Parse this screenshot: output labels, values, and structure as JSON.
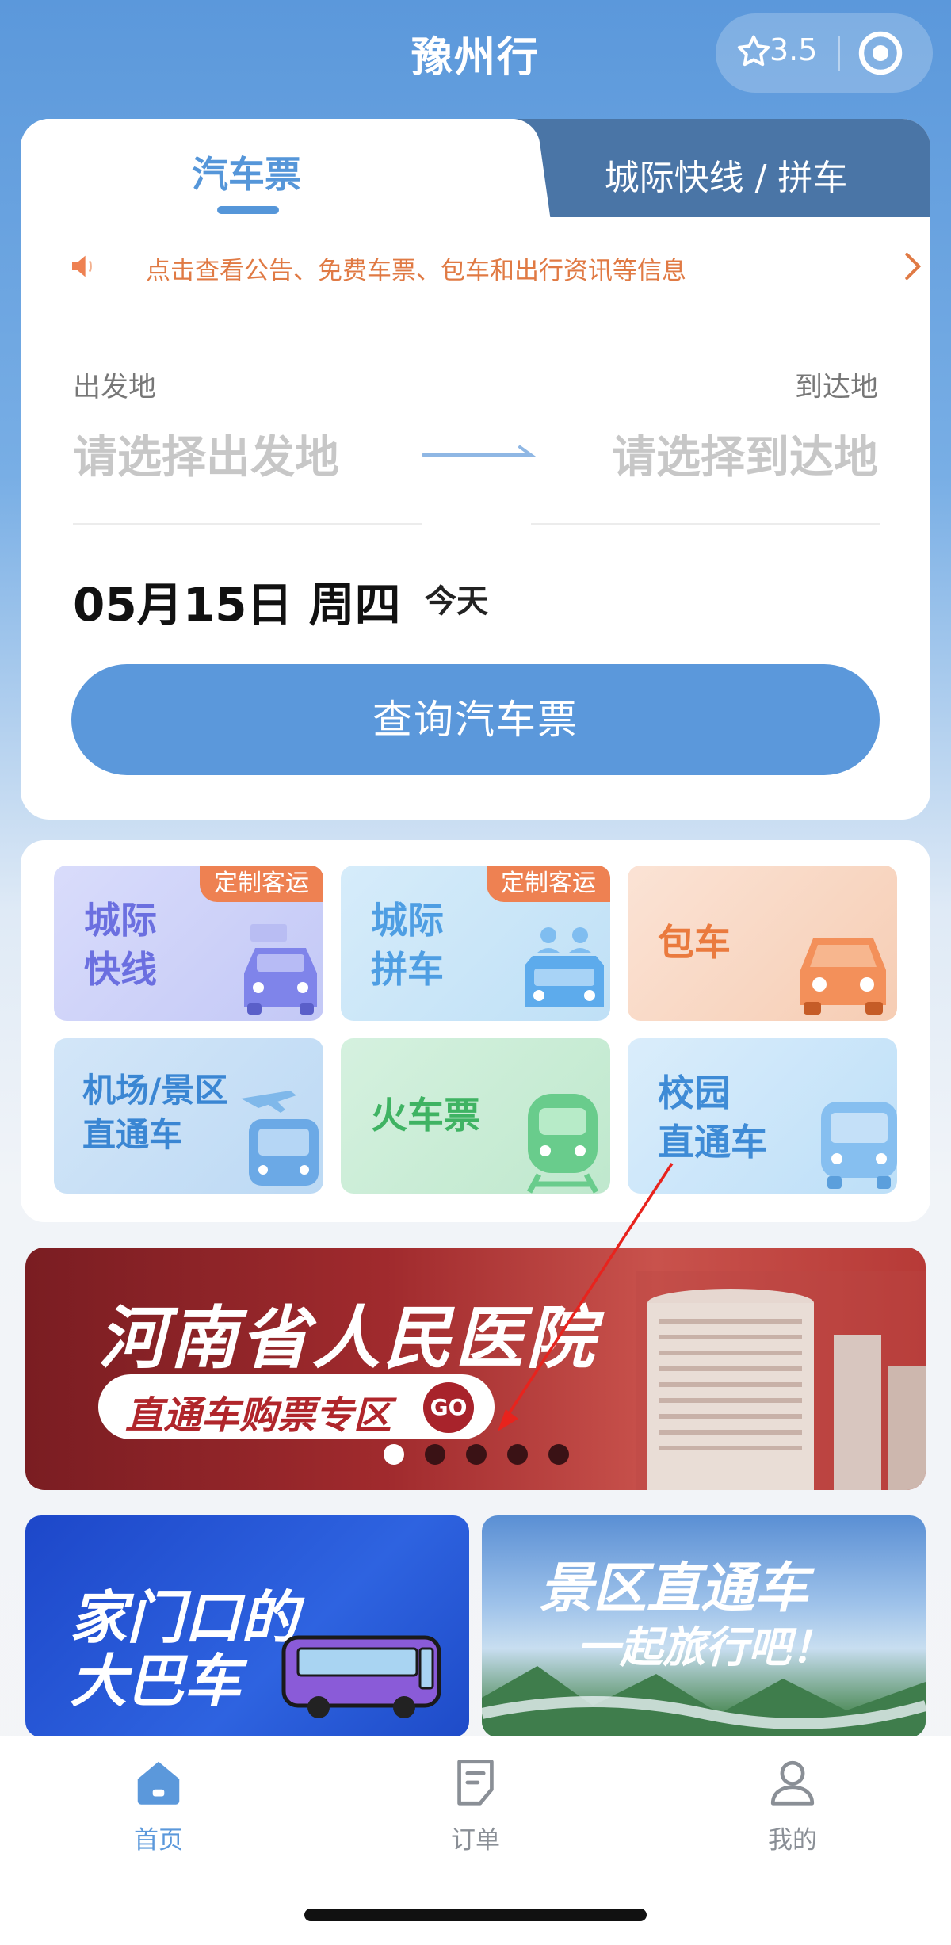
{
  "header": {
    "title": "豫州行",
    "rating": "3.5",
    "star_icon": "star-outline-icon",
    "menu_icon": "target-icon"
  },
  "ticket": {
    "tab_active": "汽车票",
    "tab_inactive": "城际快线 / 拼车",
    "notice": "点击查看公告、免费车票、包车和出行资讯等信息",
    "from_label": "出发地",
    "to_label": "到达地",
    "from_placeholder": "请选择出发地",
    "to_placeholder": "请选择到达地",
    "date": "05月15日 周四",
    "today": "今天",
    "search_button": "查询汽车票"
  },
  "services": [
    {
      "line1": "城际",
      "line2": "快线",
      "badge": "定制客运"
    },
    {
      "line1": "城际",
      "line2": "拼车",
      "badge": "定制客运"
    },
    {
      "line1": "包车",
      "line2": "",
      "badge": ""
    },
    {
      "line1": "机场/景区",
      "line2": "直通车",
      "badge": ""
    },
    {
      "line1": "火车票",
      "line2": "",
      "badge": ""
    },
    {
      "line1": "校园",
      "line2": "直通车",
      "badge": ""
    }
  ],
  "banner": {
    "headline": "河南省人民医院",
    "pill": "直通车购票专区",
    "go": "GO",
    "dots_total": 5,
    "dots_active_index": 0
  },
  "promos": {
    "left_line1": "家门口的",
    "left_line2": "大巴车",
    "right_line1": "景区直通车",
    "right_line2": "一起旅行吧！"
  },
  "nav": {
    "home": "首页",
    "orders": "订单",
    "mine": "我的"
  },
  "colors": {
    "primary": "#5b98db",
    "tab_dark": "#4a75a6",
    "notice_orange": "#e07a44",
    "badge_orange": "#ee8152"
  }
}
